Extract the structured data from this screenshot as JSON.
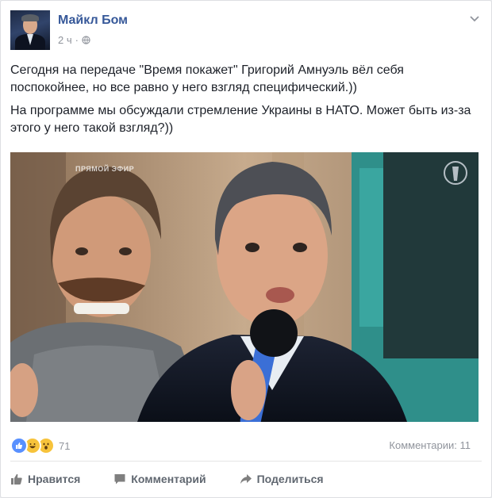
{
  "post": {
    "author": "Майкл Бом",
    "time": "2 ч",
    "paragraphs": [
      "Сегодня на передаче \"Время покажет\" Григорий Амнуэль вёл себя поспокойнее, но все равно у него взгляд специфический.))",
      "На программе мы обсуждали стремление Украины в НАТО. Может быть из-за этого у него такой взгляд?))"
    ],
    "photo_overlay_text": "ПРЯМОЙ ЭФИР"
  },
  "reactions": {
    "icons": [
      "like-icon",
      "haha-icon",
      "wow-icon"
    ],
    "count": "71"
  },
  "comments_count_label": "Комментарии: 11",
  "actions": {
    "like": "Нравится",
    "comment": "Комментарий",
    "share": "Поделиться"
  },
  "colors": {
    "author_link": "#365899",
    "meta_text": "#90949c",
    "like_blue": "#5890ff",
    "reaction_yellow": "#f7c33b",
    "action_text": "#606770"
  }
}
